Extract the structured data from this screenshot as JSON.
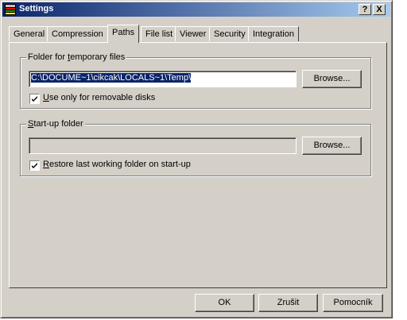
{
  "window": {
    "title": "Settings",
    "help_button": "?",
    "close_button": "X"
  },
  "tabs": [
    {
      "label": "General"
    },
    {
      "label": "Compression"
    },
    {
      "label": "Paths"
    },
    {
      "label": "File list"
    },
    {
      "label": "Viewer"
    },
    {
      "label": "Security"
    },
    {
      "label": "Integration"
    }
  ],
  "active_tab": "Paths",
  "temp_group": {
    "legend_prefix": "Folder for ",
    "legend_accel": "t",
    "legend_suffix": "emporary files",
    "path_value": "C:\\DOCUME~1\\cikcak\\LOCALS~1\\Temp\\",
    "browse_label": "Browse...",
    "checkbox_accel": "U",
    "checkbox_rest": "se only for removable disks",
    "checkbox_checked": true
  },
  "startup_group": {
    "legend_accel": "S",
    "legend_rest": "tart-up folder",
    "path_value": "",
    "browse_label": "Browse...",
    "checkbox_accel": "R",
    "checkbox_rest": "estore last working folder on start-up",
    "checkbox_checked": true
  },
  "footer": {
    "ok_label": "OK",
    "cancel_label": "Zrušit",
    "help_label": "Pomocník"
  }
}
